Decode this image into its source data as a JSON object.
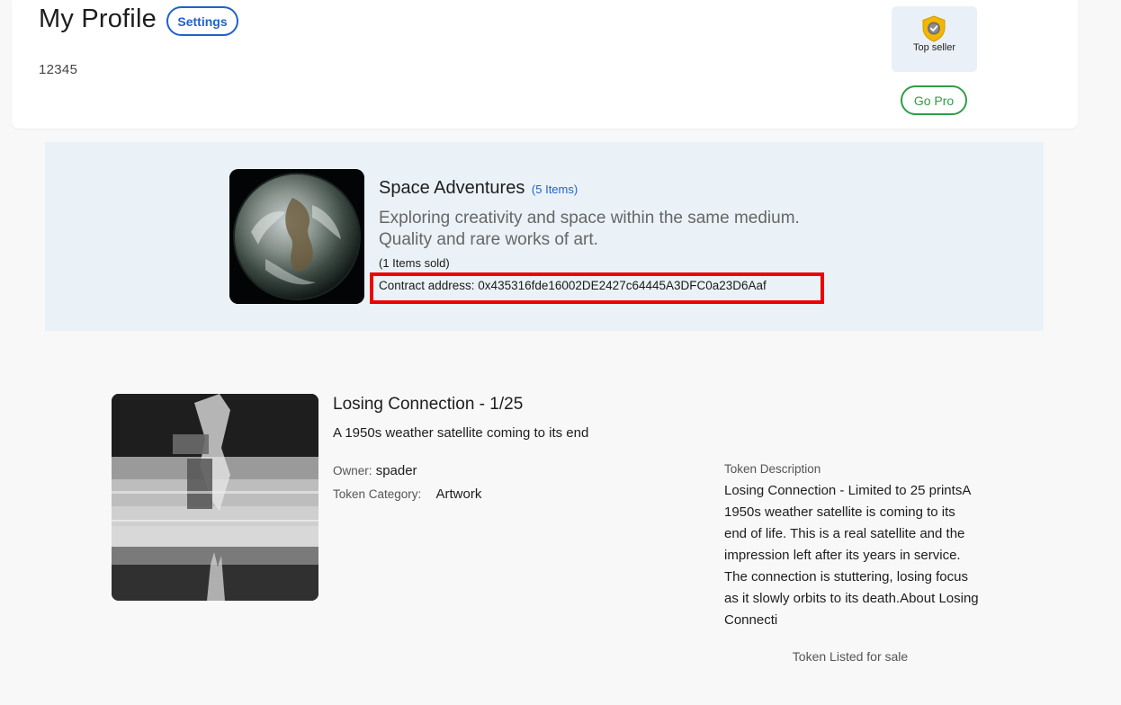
{
  "profile": {
    "title": "My Profile",
    "settings_label": "Settings",
    "user_id": "12345",
    "badge_label": "Top seller",
    "badge_icon": "shield-check-icon",
    "gopro_label": "Go Pro"
  },
  "collection": {
    "name": "Space Adventures",
    "item_count": "(5 Items)",
    "description": "Exploring creativity and space within the same medium. Quality and rare works of art.",
    "sold": "(1 Items sold)",
    "contract_address": "Contract address: 0x435316fde16002DE2427c64445A3DFC0a23D6Aaf",
    "image": "earth-from-space-image"
  },
  "token": {
    "title": "Losing Connection - 1/25",
    "subtitle": "A 1950s weather satellite coming to its end",
    "owner_label": "Owner:",
    "owner_value": "spader",
    "category_label": "Token Category:",
    "category_value": "Artwork",
    "description_heading": "Token Description",
    "description": "Losing Connection - Limited to 25 printsA 1950s weather satellite is coming to its end of life. This is a real satellite and the impression left after its years in service. The connection is stuttering, losing focus as it slowly orbits to its death.About Losing Connecti",
    "status": "Token Listed for sale",
    "image": "satellite-glitch-image"
  },
  "colors": {
    "accent_blue": "#1f62c9",
    "accent_green": "#2e9e48",
    "highlight_red": "#ee0000",
    "banner_bg": "#eaf2f7"
  }
}
